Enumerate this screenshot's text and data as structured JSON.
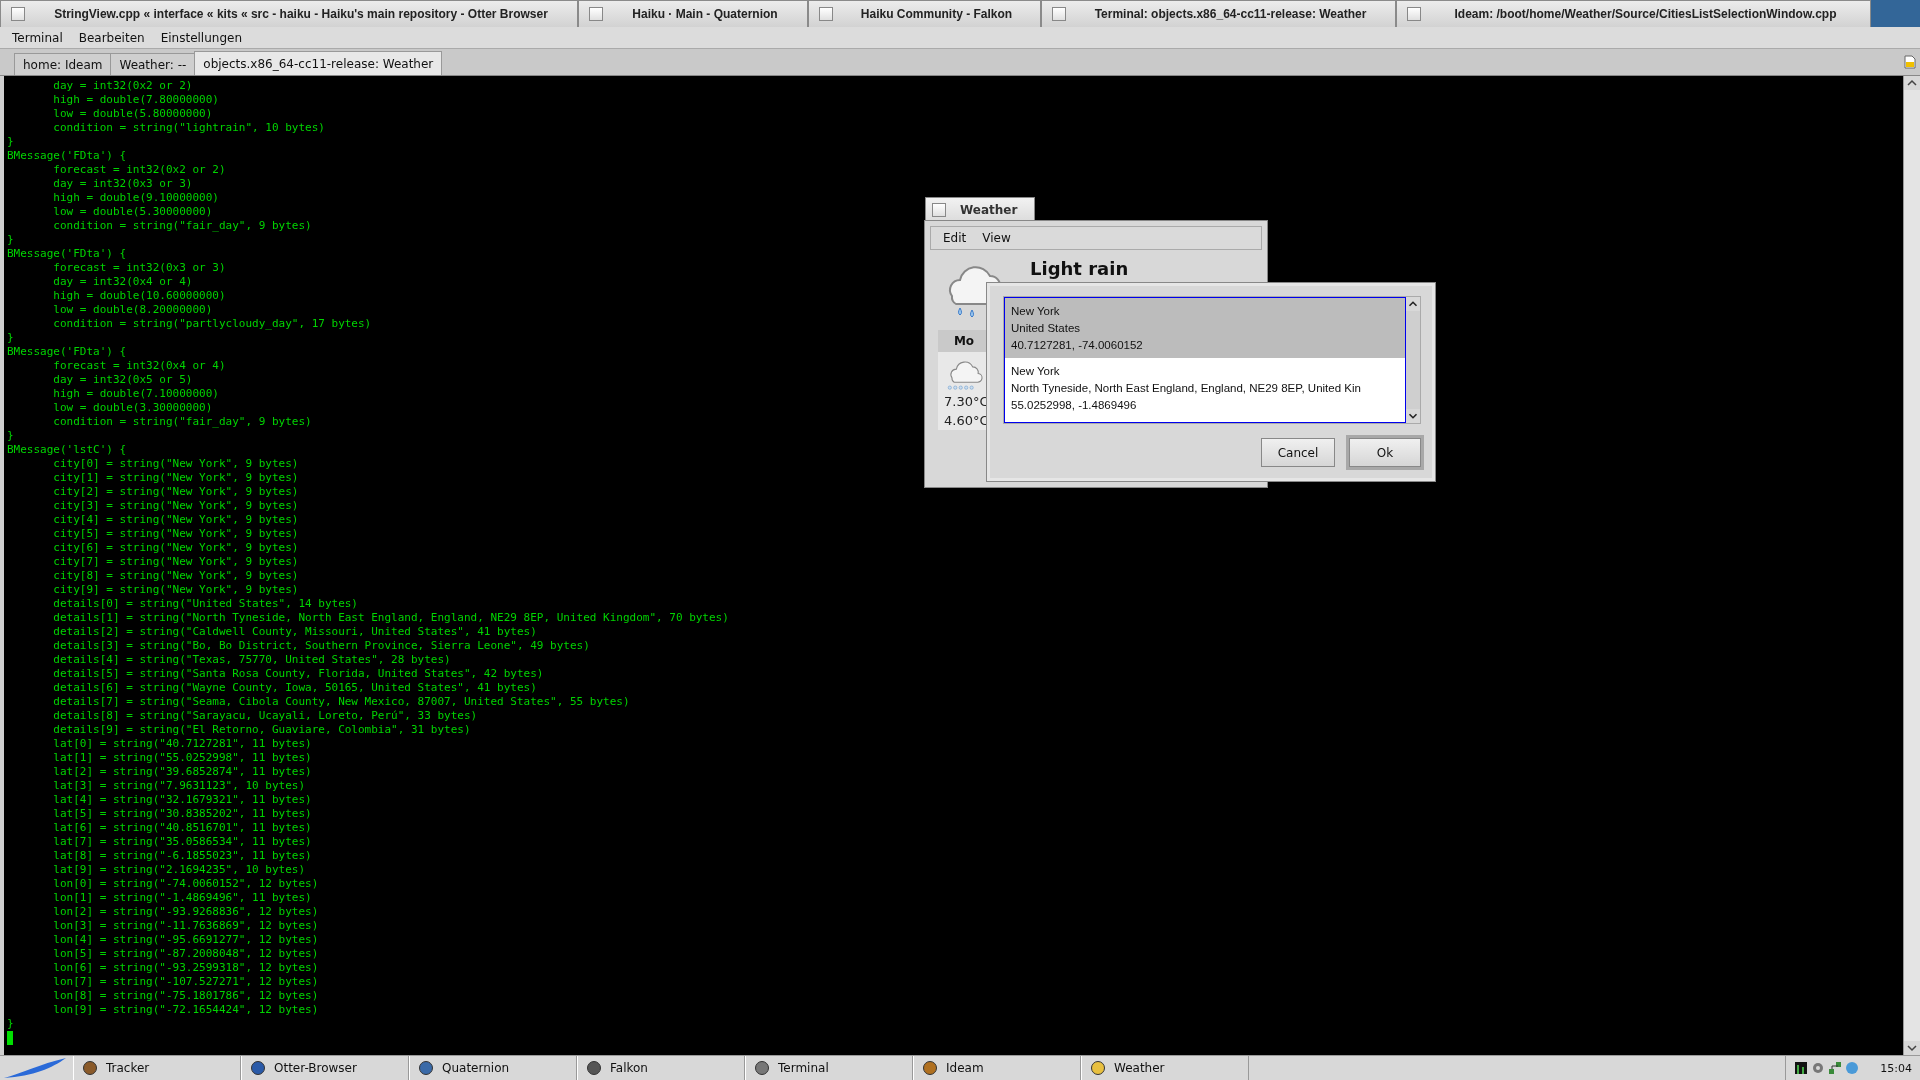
{
  "window_tabs": [
    {
      "title": "StringView.cpp « interface « kits « src - haiku - Haiku's main repository - Otter Browser"
    },
    {
      "title": "Haiku · Main - Quaternion"
    },
    {
      "title": "Haiku Community - Falkon"
    },
    {
      "title": "Terminal: objects.x86_64-cc11-release: Weather"
    },
    {
      "title": "Ideam: /boot/home/Weather/Source/CitiesListSelectionWindow.cpp"
    }
  ],
  "menu": [
    "Terminal",
    "Bearbeiten",
    "Einstellungen"
  ],
  "terminal_tabs": [
    {
      "label": "home: Ideam",
      "selected": false
    },
    {
      "label": "Weather: --",
      "selected": false
    },
    {
      "label": "objects.x86_64-cc11-release: Weather",
      "selected": true
    }
  ],
  "terminal_lines": [
    "\tday = int32(0x2 or 2)",
    "\thigh = double(7.80000000)",
    "\tlow = double(5.80000000)",
    "\tcondition = string(\"lightrain\", 10 bytes)",
    "}",
    "BMessage('FDta') {",
    "\tforecast = int32(0x2 or 2)",
    "\tday = int32(0x3 or 3)",
    "\thigh = double(9.10000000)",
    "\tlow = double(5.30000000)",
    "\tcondition = string(\"fair_day\", 9 bytes)",
    "}",
    "BMessage('FDta') {",
    "\tforecast = int32(0x3 or 3)",
    "\tday = int32(0x4 or 4)",
    "\thigh = double(10.60000000)",
    "\tlow = double(8.20000000)",
    "\tcondition = string(\"partlycloudy_day\", 17 bytes)",
    "}",
    "BMessage('FDta') {",
    "\tforecast = int32(0x4 or 4)",
    "\tday = int32(0x5 or 5)",
    "\thigh = double(7.10000000)",
    "\tlow = double(3.30000000)",
    "\tcondition = string(\"fair_day\", 9 bytes)",
    "}",
    "BMessage('lstC') {",
    "\tcity[0] = string(\"New York\", 9 bytes)",
    "\tcity[1] = string(\"New York\", 9 bytes)",
    "\tcity[2] = string(\"New York\", 9 bytes)",
    "\tcity[3] = string(\"New York\", 9 bytes)",
    "\tcity[4] = string(\"New York\", 9 bytes)",
    "\tcity[5] = string(\"New York\", 9 bytes)",
    "\tcity[6] = string(\"New York\", 9 bytes)",
    "\tcity[7] = string(\"New York\", 9 bytes)",
    "\tcity[8] = string(\"New York\", 9 bytes)",
    "\tcity[9] = string(\"New York\", 9 bytes)",
    "\tdetails[0] = string(\"United States\", 14 bytes)",
    "\tdetails[1] = string(\"North Tyneside, North East England, England, NE29 8EP, United Kingdom\", 70 bytes)",
    "\tdetails[2] = string(\"Caldwell County, Missouri, United States\", 41 bytes)",
    "\tdetails[3] = string(\"Bo, Bo District, Southern Province, Sierra Leone\", 49 bytes)",
    "\tdetails[4] = string(\"Texas, 75770, United States\", 28 bytes)",
    "\tdetails[5] = string(\"Santa Rosa County, Florida, United States\", 42 bytes)",
    "\tdetails[6] = string(\"Wayne County, Iowa, 50165, United States\", 41 bytes)",
    "\tdetails[7] = string(\"Seama, Cibola County, New Mexico, 87007, United States\", 55 bytes)",
    "\tdetails[8] = string(\"Sarayacu, Ucayali, Loreto, Perú\", 33 bytes)",
    "\tdetails[9] = string(\"El Retorno, Guaviare, Colombia\", 31 bytes)",
    "\tlat[0] = string(\"40.7127281\", 11 bytes)",
    "\tlat[1] = string(\"55.0252998\", 11 bytes)",
    "\tlat[2] = string(\"39.6852874\", 11 bytes)",
    "\tlat[3] = string(\"7.9631123\", 10 bytes)",
    "\tlat[4] = string(\"32.1679321\", 11 bytes)",
    "\tlat[5] = string(\"30.8385202\", 11 bytes)",
    "\tlat[6] = string(\"40.8516701\", 11 bytes)",
    "\tlat[7] = string(\"35.0586534\", 11 bytes)",
    "\tlat[8] = string(\"-6.1855023\", 11 bytes)",
    "\tlat[9] = string(\"2.1694235\", 10 bytes)",
    "\tlon[0] = string(\"-74.0060152\", 12 bytes)",
    "\tlon[1] = string(\"-1.4869496\", 11 bytes)",
    "\tlon[2] = string(\"-93.9268836\", 12 bytes)",
    "\tlon[3] = string(\"-11.7636869\", 12 bytes)",
    "\tlon[4] = string(\"-95.6691277\", 12 bytes)",
    "\tlon[5] = string(\"-87.2008048\", 12 bytes)",
    "\tlon[6] = string(\"-93.2599318\", 12 bytes)",
    "\tlon[7] = string(\"-107.527271\", 12 bytes)",
    "\tlon[8] = string(\"-75.1801786\", 12 bytes)",
    "\tlon[9] = string(\"-72.1654424\", 12 bytes)",
    "}"
  ],
  "weather_window": {
    "title": "Weather",
    "menu": [
      "Edit",
      "View"
    ],
    "condition": "Light rain",
    "forecast": {
      "day": "Mo",
      "high": "7.30°C",
      "low": "4.60°C"
    }
  },
  "dialog": {
    "items": [
      {
        "city": "New York",
        "details": "United States",
        "coords": "40.7127281, -74.0060152",
        "selected": true
      },
      {
        "city": "New York",
        "details": "North Tyneside, North East England, England, NE29 8EP, United Kin",
        "coords": "55.0252998, -1.4869496",
        "selected": false
      }
    ],
    "buttons": [
      {
        "label": "Cancel",
        "default": false
      },
      {
        "label": "Ok",
        "default": true
      }
    ]
  },
  "taskbar": {
    "items": [
      "Tracker",
      "Otter-Browser",
      "Quaternion",
      "Falkon",
      "Terminal",
      "Ideam",
      "Weather"
    ],
    "clock": "15:04"
  }
}
